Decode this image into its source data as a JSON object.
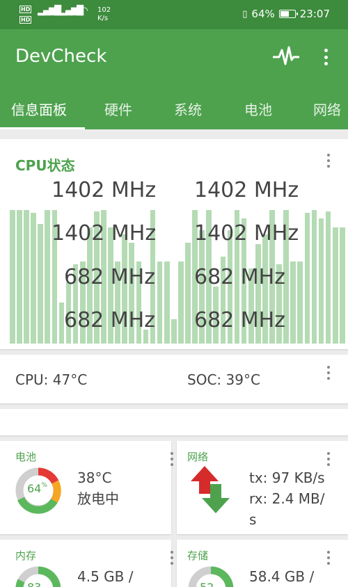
{
  "status_bar": {
    "net_speed": "102",
    "net_speed_unit": "K/s",
    "battery_percent": "64%",
    "battery_fraction": 0.64,
    "time": "23:07",
    "hd_label": "HD",
    "sim_tag": "4G"
  },
  "app": {
    "title": "DevCheck"
  },
  "tabs": [
    "信息面板",
    "硬件",
    "系统",
    "电池",
    "网络"
  ],
  "cpu_card": {
    "title": "CPU状态",
    "frequencies": [
      "1402 MHz",
      "1402 MHz",
      "1402 MHz",
      "1402 MHz",
      "682 MHz",
      "682 MHz",
      "682 MHz",
      "682 MHz"
    ]
  },
  "temp_card": {
    "cpu_temp": "CPU: 47°C",
    "soc_temp": "SOC: 39°C"
  },
  "battery_card": {
    "title": "电池",
    "percent": "64",
    "percent_unit": "%",
    "temperature": "38°C",
    "status": "放电中"
  },
  "network_card": {
    "title": "网络",
    "tx": "tx: 97 KB/s",
    "rx_line1": "rx: 2.4 MB/",
    "rx_line2": "s"
  },
  "memory_card": {
    "title": "内存",
    "value": "4.5 GB /",
    "percent": "83"
  },
  "storage_card": {
    "title": "存储",
    "value": "58.4 GB /",
    "percent": "52"
  },
  "colors": {
    "primary": "#4ea24e",
    "status_bar": "#3d8b3d",
    "bar_fill": "#b4dbb4",
    "gauge_red": "#e53935",
    "gauge_orange": "#f5a623",
    "gauge_green": "#5cb85c"
  }
}
